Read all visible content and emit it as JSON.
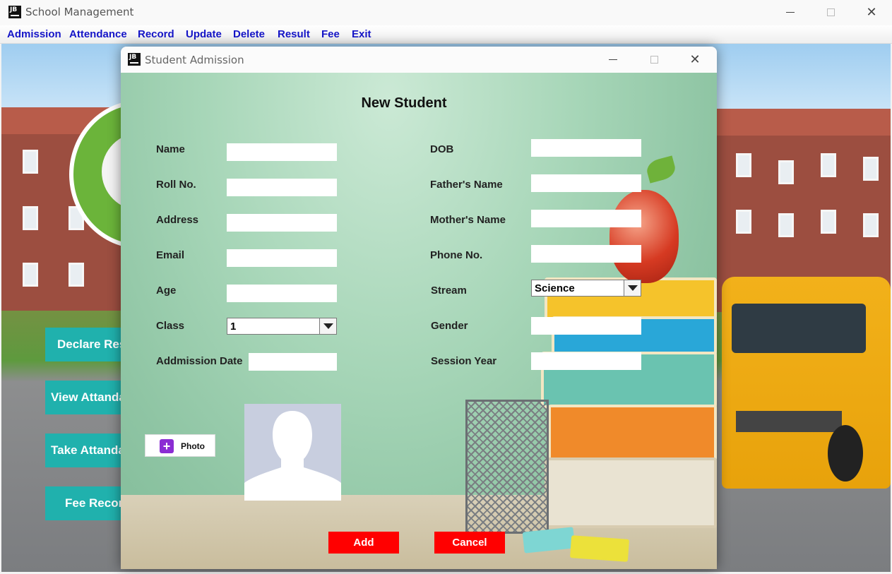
{
  "main_window": {
    "title": "School Management",
    "icon_text": "JB"
  },
  "menu": {
    "items": [
      "Admission",
      "Attendance",
      "Record",
      "Update",
      "Delete",
      "Result",
      "Fee",
      "Exit"
    ]
  },
  "side_buttons": [
    "Declare Result",
    "View Attandance",
    "Take Attandance",
    "Fee Record"
  ],
  "dialog": {
    "title": "Student Admission",
    "icon_text": "JB",
    "heading": "New Student",
    "left_fields": {
      "name": {
        "label": "Name",
        "value": ""
      },
      "roll": {
        "label": "Roll No.",
        "value": ""
      },
      "address": {
        "label": "Address",
        "value": ""
      },
      "email": {
        "label": "Email",
        "value": ""
      },
      "age": {
        "label": "Age",
        "value": ""
      },
      "class": {
        "label": "Class",
        "value": "1"
      },
      "admission_date": {
        "label": "Addmission Date",
        "value": ""
      }
    },
    "right_fields": {
      "dob": {
        "label": "DOB",
        "value": ""
      },
      "father": {
        "label": "Father's Name",
        "value": ""
      },
      "mother": {
        "label": "Mother's Name",
        "value": ""
      },
      "phone": {
        "label": "Phone No.",
        "value": ""
      },
      "stream": {
        "label": "Stream",
        "value": "Science"
      },
      "gender": {
        "label": "Gender",
        "value": ""
      },
      "session": {
        "label": "Session Year",
        "value": ""
      }
    },
    "photo_button": "Photo",
    "add_button": "Add",
    "cancel_button": "Cancel"
  },
  "colors": {
    "menu_text": "#1515c8",
    "side_button": "#20b1ad",
    "action_button": "#ff0000"
  }
}
